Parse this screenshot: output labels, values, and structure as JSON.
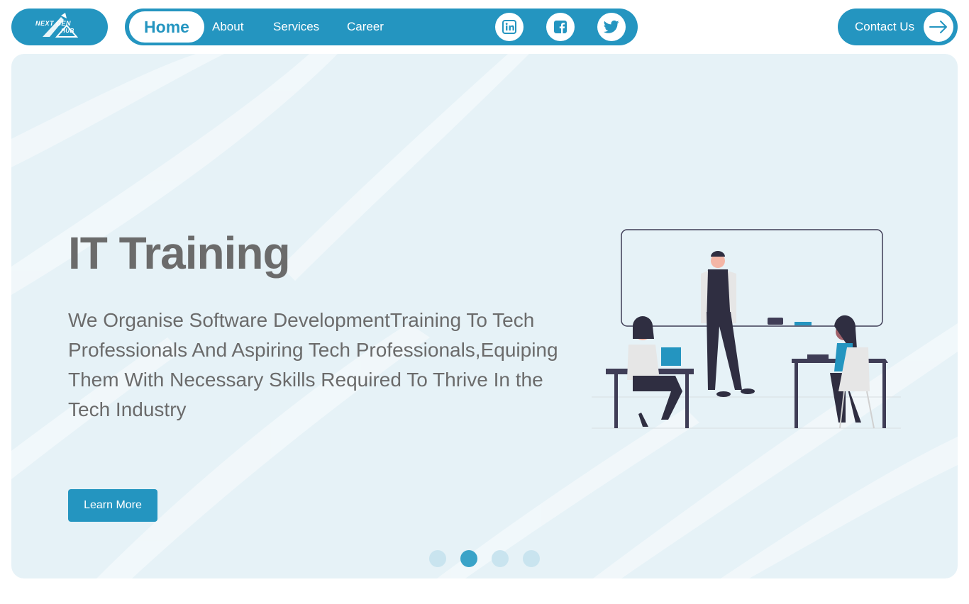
{
  "header": {
    "logo": {
      "line1": "NEXT GEN",
      "line2": "HUB"
    },
    "nav": {
      "home": "Home",
      "about": "About",
      "services": "Services",
      "career": "Career"
    },
    "social": [
      "linkedin-icon",
      "facebook-icon",
      "twitter-icon"
    ],
    "contact_label": "Contact Us"
  },
  "hero": {
    "title": "IT Training",
    "description": "We Organise Software DevelopmentTraining To Tech Professionals And Aspiring Tech Professionals,Equiping Them With Necessary Skills Required To Thrive In the Tech Industry",
    "button_label": "Learn More",
    "slides_total": 4,
    "active_slide": 2
  },
  "colors": {
    "primary": "#2495c0",
    "hero_bg": "#e6f2f7",
    "text": "#6b6b6b",
    "dot_inactive": "#c9e4ef",
    "dot_active": "#3aa3c8"
  }
}
